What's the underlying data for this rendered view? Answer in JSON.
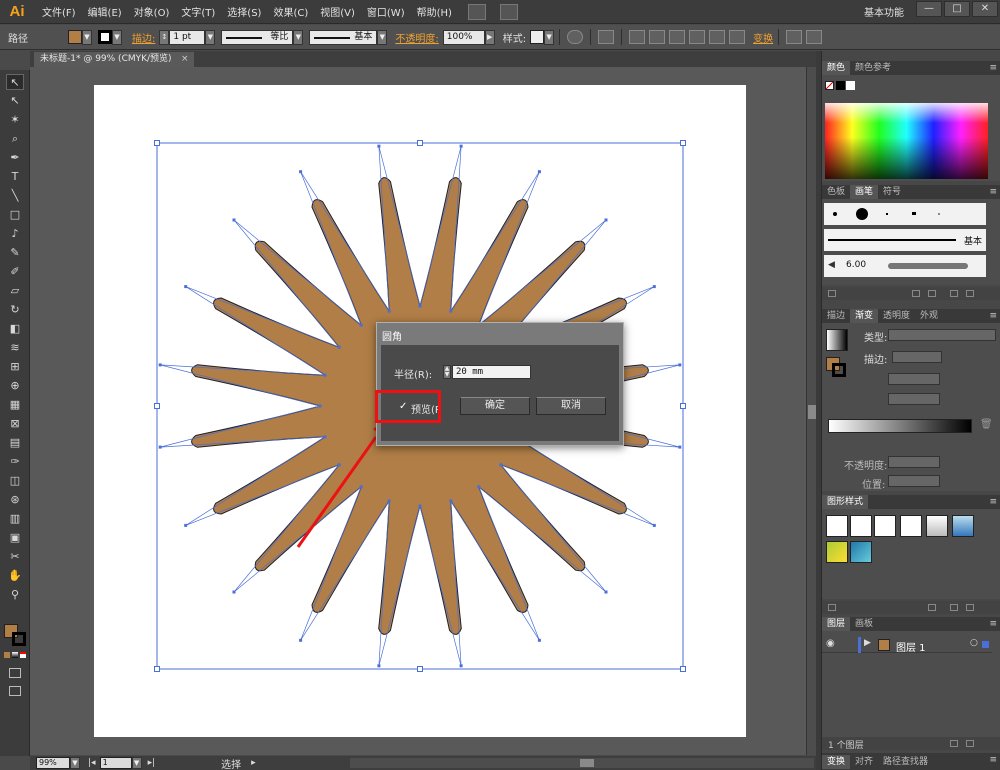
{
  "app": {
    "logo": "Ai",
    "menu": [
      "文件(F)",
      "编辑(E)",
      "对象(O)",
      "文字(T)",
      "选择(S)",
      "效果(C)",
      "视图(V)",
      "窗口(W)",
      "帮助(H)"
    ],
    "workspace": "基本功能",
    "window_buttons": [
      "—",
      "□",
      "✕"
    ]
  },
  "control_bar": {
    "object_type": "路径",
    "stroke_link": "描边:",
    "stroke_weight": "1 pt",
    "profile_label": "等比",
    "brush_label": "基本",
    "opacity_link": "不透明度:",
    "opacity_value": "100%",
    "style_label": "样式:",
    "transform_link": "变换",
    "colors": {
      "fill": "#b07e46",
      "stroke": "#000000"
    }
  },
  "document": {
    "tab_title": "未标题-1* @ 99% (CMYK/预览)",
    "tab_close": "×"
  },
  "tools": [
    "selection-icon",
    "direct-selection-icon",
    "magic-wand-icon",
    "lasso-icon",
    "pen-icon",
    "type-icon",
    "line-icon",
    "rectangle-icon",
    "paintbrush-icon",
    "pencil-icon",
    "blob-brush-icon",
    "eraser-icon",
    "rotate-icon",
    "scale-icon",
    "warp-icon",
    "free-transform-icon",
    "shape-builder-icon",
    "perspective-icon",
    "mesh-icon",
    "gradient-icon",
    "eyedropper-icon",
    "blend-icon",
    "symbol-sprayer-icon",
    "graph-icon",
    "artboard-icon",
    "slice-icon",
    "hand-icon",
    "zoom-icon"
  ],
  "tool_glyphs": [
    "↖",
    "↖",
    "✶",
    "⌕",
    "✒",
    "T",
    "╲",
    "□",
    "♪",
    "✎",
    "✐",
    "▱",
    "↻",
    "◧",
    "≋",
    "⊞",
    "⊕",
    "▦",
    "⊠",
    "▤",
    "✑",
    "◫",
    "⊛",
    "▥",
    "▣",
    "✂",
    "✋",
    "⚲"
  ],
  "artwork": {
    "fill_color": "#b07e46",
    "selection_color": "#4a6fd8"
  },
  "dialog": {
    "title": "圆角",
    "radius_label": "半径(R):",
    "radius_value": "20 mm",
    "preview_check": "✓",
    "preview_label": "预览(P",
    "ok_label": "确定",
    "cancel_label": "取消"
  },
  "status_bar": {
    "zoom": "99%",
    "artboard_num": "1",
    "tool_status": "选择"
  },
  "panels": {
    "color": {
      "tabs": [
        "颜色",
        "颜色参考"
      ]
    },
    "brushes": {
      "tabs": [
        "色板",
        "画笔",
        "符号"
      ],
      "basic_label": "基本",
      "size_value": "6.00"
    },
    "stroke_gradient": {
      "tabs": [
        "描边",
        "渐变",
        "透明度",
        "外观"
      ],
      "type_label": "类型:",
      "stroke_label": "描边:",
      "opacity_label": "不透明度:",
      "position_label": "位置:"
    },
    "graphic_styles": {
      "tabs": [
        "图形样式"
      ]
    },
    "layers": {
      "tabs": [
        "图层",
        "画板"
      ],
      "layer_name": "图层 1",
      "footer_label": "1 个图层"
    },
    "bottom": {
      "tabs": [
        "变换",
        "对齐",
        "路径查找器"
      ]
    }
  }
}
